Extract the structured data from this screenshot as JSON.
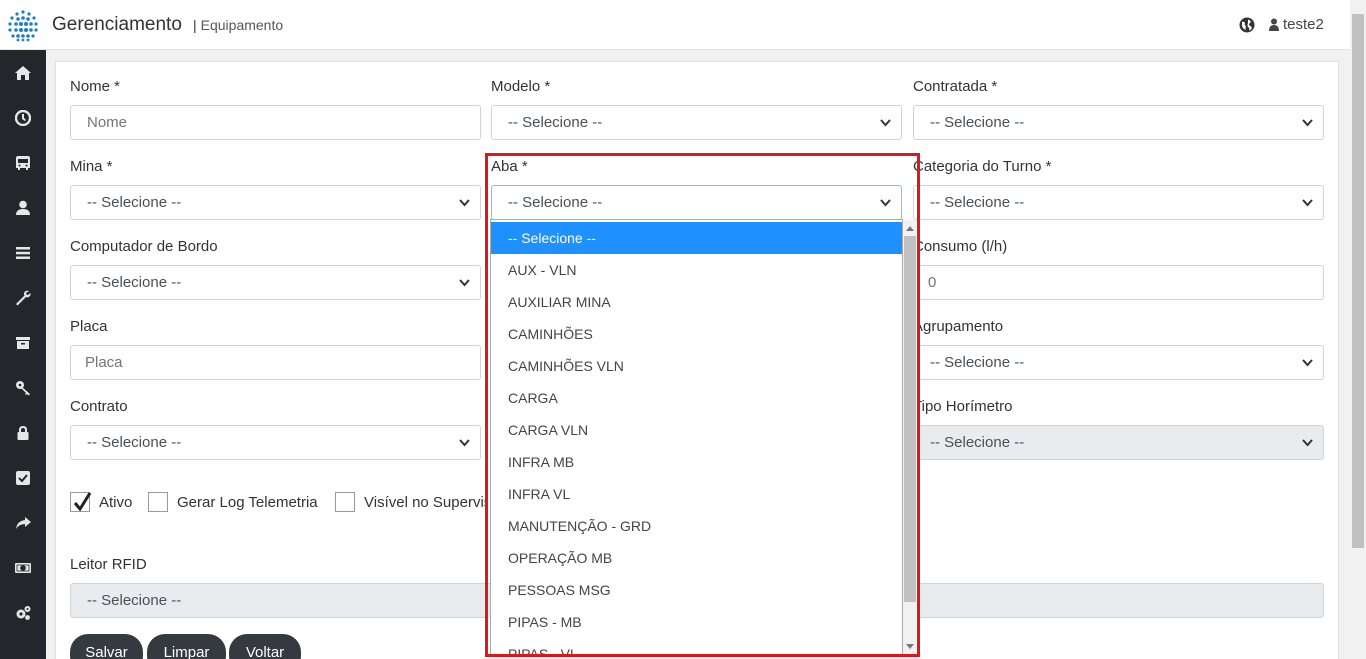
{
  "header": {
    "title": "Gerenciamento",
    "separator": "|",
    "subtitle": "Equipamento",
    "user": "teste2"
  },
  "sidebar": {
    "items": [
      "home-icon",
      "clock-icon",
      "bus-icon",
      "user-icon",
      "menu-icon",
      "wrench-icon",
      "archive-icon",
      "key-icon",
      "lock-icon",
      "check-square-icon",
      "share-icon",
      "money-icon",
      "cogs-icon"
    ]
  },
  "form": {
    "nome": {
      "label": "Nome *",
      "placeholder": "Nome"
    },
    "modelo": {
      "label": "Modelo *",
      "value": "-- Selecione --"
    },
    "contratada": {
      "label": "Contratada *",
      "value": "-- Selecione --"
    },
    "mina": {
      "label": "Mina *",
      "value": "-- Selecione --"
    },
    "aba": {
      "label": "Aba *",
      "value": "-- Selecione --"
    },
    "categoria_turno": {
      "label": "Categoria do Turno *",
      "value": "-- Selecione --"
    },
    "computador_bordo": {
      "label": "Computador de Bordo",
      "value": "-- Selecione --"
    },
    "consumo": {
      "label": "Consumo (l/h)",
      "placeholder": "0"
    },
    "placa": {
      "label": "Placa",
      "placeholder": "Placa"
    },
    "agrupamento": {
      "label": "Agrupamento",
      "value": "-- Selecione --"
    },
    "contrato": {
      "label": "Contrato",
      "value": "-- Selecione --"
    },
    "tipo_horimetro": {
      "label": "Tipo Horímetro",
      "value": "-- Selecione --"
    },
    "ativo": {
      "label": "Ativo",
      "checked": true
    },
    "gerar_log": {
      "label": "Gerar Log Telemetria",
      "checked": false
    },
    "visivel_supervisorio": {
      "label": "Visível no Supervisório",
      "checked": false
    },
    "leitor_rfid": {
      "label": "Leitor RFID",
      "value": "-- Selecione --"
    }
  },
  "buttons": {
    "salvar": "Salvar",
    "limpar": "Limpar",
    "voltar": "Voltar"
  },
  "aba_dropdown": {
    "selected_index": 0,
    "options": [
      "-- Selecione --",
      "AUX - VLN",
      "AUXILIAR MINA",
      "CAMINHÕES",
      "CAMINHÕES VLN",
      "CARGA",
      "CARGA VLN",
      "INFRA MB",
      "INFRA VL",
      "MANUTENÇÃO - GRD",
      "OPERAÇÃO MB",
      "PESSOAS MSG",
      "PIPAS - MB",
      "PIPAS - VL"
    ]
  },
  "colors": {
    "sidebar_bg": "#23272b",
    "selected_option": "#1e90ff",
    "highlight_border": "#e0161b",
    "button_bg": "#343a40"
  }
}
